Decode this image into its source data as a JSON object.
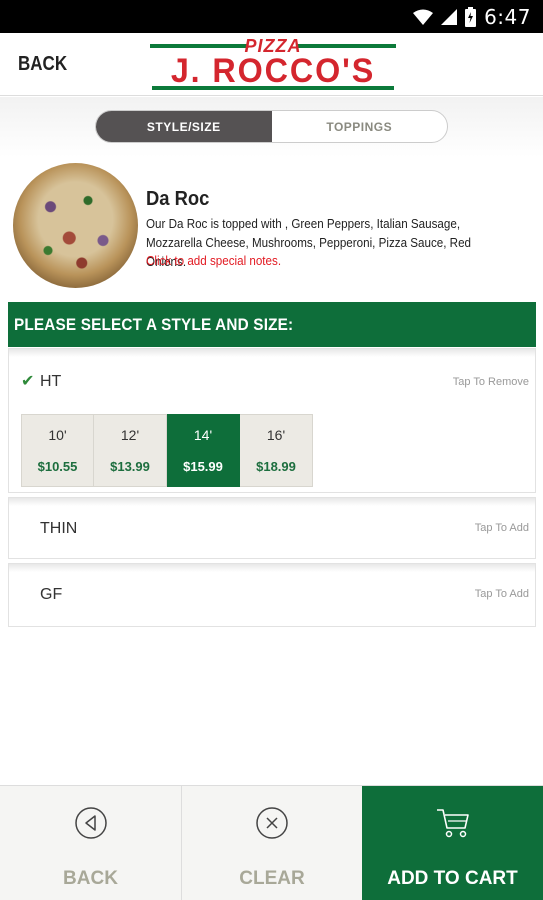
{
  "status_bar": {
    "time": "6:47"
  },
  "header": {
    "back_label": "BACK",
    "logo_small": "PIZZA",
    "logo_name": "J. ROCCO'S"
  },
  "tabs": [
    {
      "label": "STYLE/SIZE",
      "active": true
    },
    {
      "label": "TOPPINGS",
      "active": false
    }
  ],
  "item": {
    "title": "Da Roc",
    "description": "Our Da Roc is topped with , Green Peppers, Italian Sausage, Mozzarella Cheese, Mushrooms, Pepperoni, Pizza Sauce, Red Onions.",
    "notes_link": "Click to add special notes."
  },
  "section_title": "PLEASE SELECT A STYLE AND SIZE:",
  "styles": [
    {
      "name": "HT",
      "action": "Tap To Remove",
      "checked": true,
      "sizes": [
        {
          "inch": "10'",
          "price": "$10.55",
          "selected": false
        },
        {
          "inch": "12'",
          "price": "$13.99",
          "selected": false
        },
        {
          "inch": "14'",
          "price": "$15.99",
          "selected": true
        },
        {
          "inch": "16'",
          "price": "$18.99",
          "selected": false
        }
      ]
    },
    {
      "name": "THIN",
      "action": "Tap To Add",
      "checked": false
    },
    {
      "name": "GF",
      "action": "Tap To Add",
      "checked": false
    }
  ],
  "bottom": {
    "back_label": "BACK",
    "clear_label": "CLEAR",
    "cart_label": "ADD TO CART",
    "back_icon": "circle-left-arrow-icon",
    "clear_icon": "circle-x-icon",
    "cart_icon": "shopping-cart-icon"
  },
  "colors": {
    "brand_green": "#0e6e3a",
    "brand_red": "#d4262e",
    "price_green": "#1d6e3e",
    "notes_red": "#e21a22"
  }
}
